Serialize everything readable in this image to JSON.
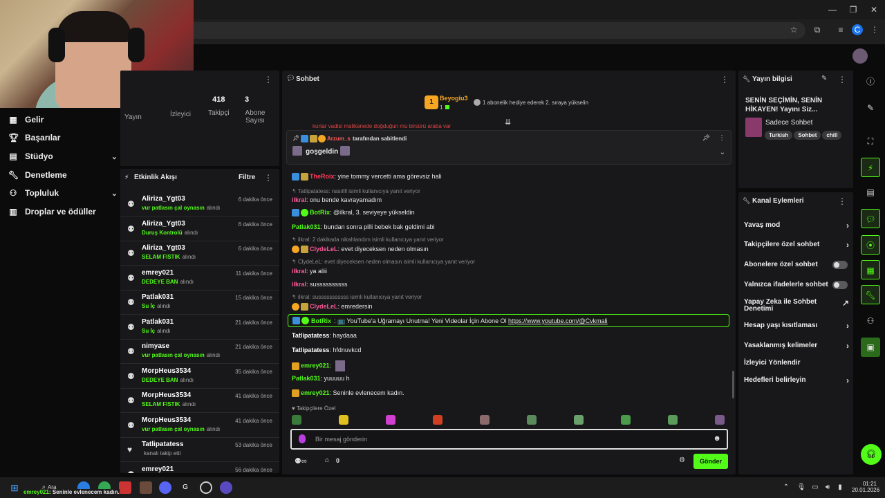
{
  "nav": {
    "items": [
      {
        "label": "Gelir",
        "icon": "dashboard-icon"
      },
      {
        "label": "Başarılar",
        "icon": "trophy-icon"
      },
      {
        "label": "Stüdyo",
        "icon": "studio-icon"
      },
      {
        "label": "Denetleme",
        "icon": "wrench-icon"
      },
      {
        "label": "Topluluk",
        "icon": "community-icon"
      },
      {
        "label": "Droplar ve ödüller",
        "icon": "drops-icon"
      }
    ]
  },
  "stats": {
    "yayin": "Yayın",
    "izleyici": "İzleyici",
    "takipci_value": "418",
    "takipci": "Takipçi",
    "abone_value": "3",
    "abone": "Abone Sayısı"
  },
  "activity": {
    "title": "Etkinlik Akışı",
    "filter": "Filtre",
    "items": [
      {
        "name": "Aliriza_Ygt03",
        "reward": "vur patlasın çal oynasın",
        "suffix": "alındı",
        "time": "6 dakika önce",
        "icon": "reward-icon"
      },
      {
        "name": "Aliriza_Ygt03",
        "reward": "Duruş Kontrolü",
        "suffix": "alındı",
        "time": "6 dakika önce",
        "icon": "reward-icon"
      },
      {
        "name": "Aliriza_Ygt03",
        "reward": "SELAM FISTIK",
        "suffix": "alındı",
        "time": "6 dakika önce",
        "icon": "reward-icon"
      },
      {
        "name": "emrey021",
        "reward": "DEDEYE BAN",
        "suffix": "alındı",
        "time": "11 dakika önce",
        "icon": "reward-icon"
      },
      {
        "name": "Patlak031",
        "reward": "Su İç",
        "suffix": "alındı",
        "time": "15 dakika önce",
        "icon": "reward-icon"
      },
      {
        "name": "Patlak031",
        "reward": "Su İç",
        "suffix": "alındı",
        "time": "21 dakika önce",
        "icon": "reward-icon"
      },
      {
        "name": "nimyase",
        "reward": "vur patlasın çal oynasın",
        "suffix": "alındı",
        "time": "21 dakika önce",
        "icon": "reward-icon"
      },
      {
        "name": "MorpHeus3534",
        "reward": "DEDEYE BAN",
        "suffix": "alındı",
        "time": "35 dakika önce",
        "icon": "reward-icon"
      },
      {
        "name": "MorpHeus3534",
        "reward": "SELAM FISTIK",
        "suffix": "alındı",
        "time": "41 dakika önce",
        "icon": "reward-icon"
      },
      {
        "name": "MorpHeus3534",
        "reward": "vur patlasın çal oynasın",
        "suffix": "alındı",
        "time": "41 dakika önce",
        "icon": "reward-icon"
      },
      {
        "name": "Tatlipatatess",
        "reward": "",
        "suffix": "kanalı takip etti",
        "time": "53 dakika önce",
        "icon": "heart-icon"
      },
      {
        "name": "emrey021",
        "reward": "",
        "suffix": "",
        "time": "56 dakika önce",
        "icon": "reward-icon"
      }
    ]
  },
  "chat": {
    "title": "Sohbet",
    "top_gifter": {
      "name": "Beyogiu3",
      "count": "1",
      "rank": "1",
      "message": "1 abonelik hediye ederek 2. sıraya yükselin"
    },
    "pinned": {
      "by": "Arzum_s",
      "by_suffix": "tarafından sabitlendi",
      "message": "goşgeldin"
    },
    "partial_line": "kurtar vadisi malikanede doğduğun mu birsürü araba var",
    "lines": [
      {
        "user": "TheRoix",
        "color": "#ff3b5c",
        "text": ": yine tommy vercetti ama görevsiz hali",
        "reply": ""
      },
      {
        "user": "",
        "color": "",
        "text": "",
        "reply": "Tatlipatatess: nasıllll isimli kullanıcıya yanıt veriyor"
      },
      {
        "user": "ilkral",
        "color": "#ff5a9a",
        "text": ": onu bende kavrayamadım",
        "reply": ""
      },
      {
        "user": "BotRix",
        "color": "#53fc18",
        "text": ": @ilkral, 3. seviyeye yükseldin",
        "reply": ""
      },
      {
        "user": "Patlak031",
        "color": "#53fc18",
        "text": ": bundan sonra pilli bebek bak geldimi abi",
        "reply": ""
      },
      {
        "user": "",
        "color": "",
        "text": "",
        "reply": "ilkral: 2 dakikada nikahlandım isimli kullanıcıya yanıt veriyor"
      },
      {
        "user": "ClydeLeL",
        "color": "#ff5a9a",
        "text": ": evet diyeceksen neden olmasın",
        "reply": ""
      },
      {
        "user": "",
        "color": "",
        "text": "",
        "reply": "ClydeLeL: evet diyeceksen neden olmasın isimli kullanıcıya yanıt veriyor"
      },
      {
        "user": "ilkral",
        "color": "#ff5a9a",
        "text": ": ya aliii",
        "reply": ""
      },
      {
        "user": "ilkral",
        "color": "#ff5a9a",
        "text": ": sussssssssss",
        "reply": ""
      },
      {
        "user": "",
        "color": "",
        "text": "",
        "reply": "ilkral: susssssssssss isimli kullanıcıya yanıt veriyor"
      },
      {
        "user": "ClydeLeL",
        "color": "#ff5a9a",
        "text": ": emredersin",
        "reply": ""
      }
    ],
    "highlight": {
      "user": "BotRix",
      "text": ": 📺 YouTube'a Uğramayı Unutma! Yeni Videolar İçin Abone Ol",
      "link": "https://www.youtube.com/@Cvkmali"
    },
    "lines2": [
      {
        "user": "Tatlipatatess",
        "color": "#ffffff",
        "text": ": haydaaa"
      },
      {
        "user": "Tatlipatatess",
        "color": "#ffffff",
        "text": ": hfdnuvkcd"
      },
      {
        "user": "emrey021",
        "color": "#53fc18",
        "text": ":"
      },
      {
        "user": "Patlak031",
        "color": "#53fc18",
        "text": ": yuuuuu h"
      },
      {
        "user": "emrey021",
        "color": "#53fc18",
        "text": ": Seninle evlenecem kadın."
      }
    ],
    "emote_section": "Takipçilere Özel",
    "input_placeholder": "Bir mesaj gönderin",
    "points": "0",
    "send": "Gönder"
  },
  "stream_info": {
    "title_label": "Yayın bilgisi",
    "stream_title": "SENİN SEÇİMİN, SENİN HİKAYEN! Yayını Siz...",
    "category": "Sadece Sohbet",
    "tags": [
      "Turkish",
      "Sohbet",
      "chill"
    ]
  },
  "channel_actions": {
    "title": "Kanal Eylemleri",
    "items": [
      {
        "label": "Yavaş mod",
        "type": "arrow"
      },
      {
        "label": "Takipçilere özel sohbet",
        "type": "arrow"
      },
      {
        "label": "Abonelere özel sohbet",
        "type": "toggle"
      },
      {
        "label": "Yalnızca ifadelerle sohbet",
        "type": "toggle"
      },
      {
        "label": "Yapay Zeka ile Sohbet Denetimi",
        "type": "external"
      },
      {
        "label": "Hesap yaşı kısıtlaması",
        "type": "arrow"
      },
      {
        "label": "Yasaklanmış kelimeler",
        "type": "arrow"
      },
      {
        "label": "İzleyici Yönlendir",
        "type": "none"
      },
      {
        "label": "Hedefleri belirleyin",
        "type": "arrow"
      }
    ]
  },
  "taskbar": {
    "search": "Ara",
    "notification": "emrey021: Seninle evlenecem kadın.",
    "notif_user": "emrey021",
    "notif_text": "Seninle evlenecem kadın.",
    "time": "01:21",
    "date": "20.01.2026"
  },
  "colors": {
    "accent": "#53fc18",
    "panel": "#18181a",
    "bg": "#0b0b0c"
  }
}
